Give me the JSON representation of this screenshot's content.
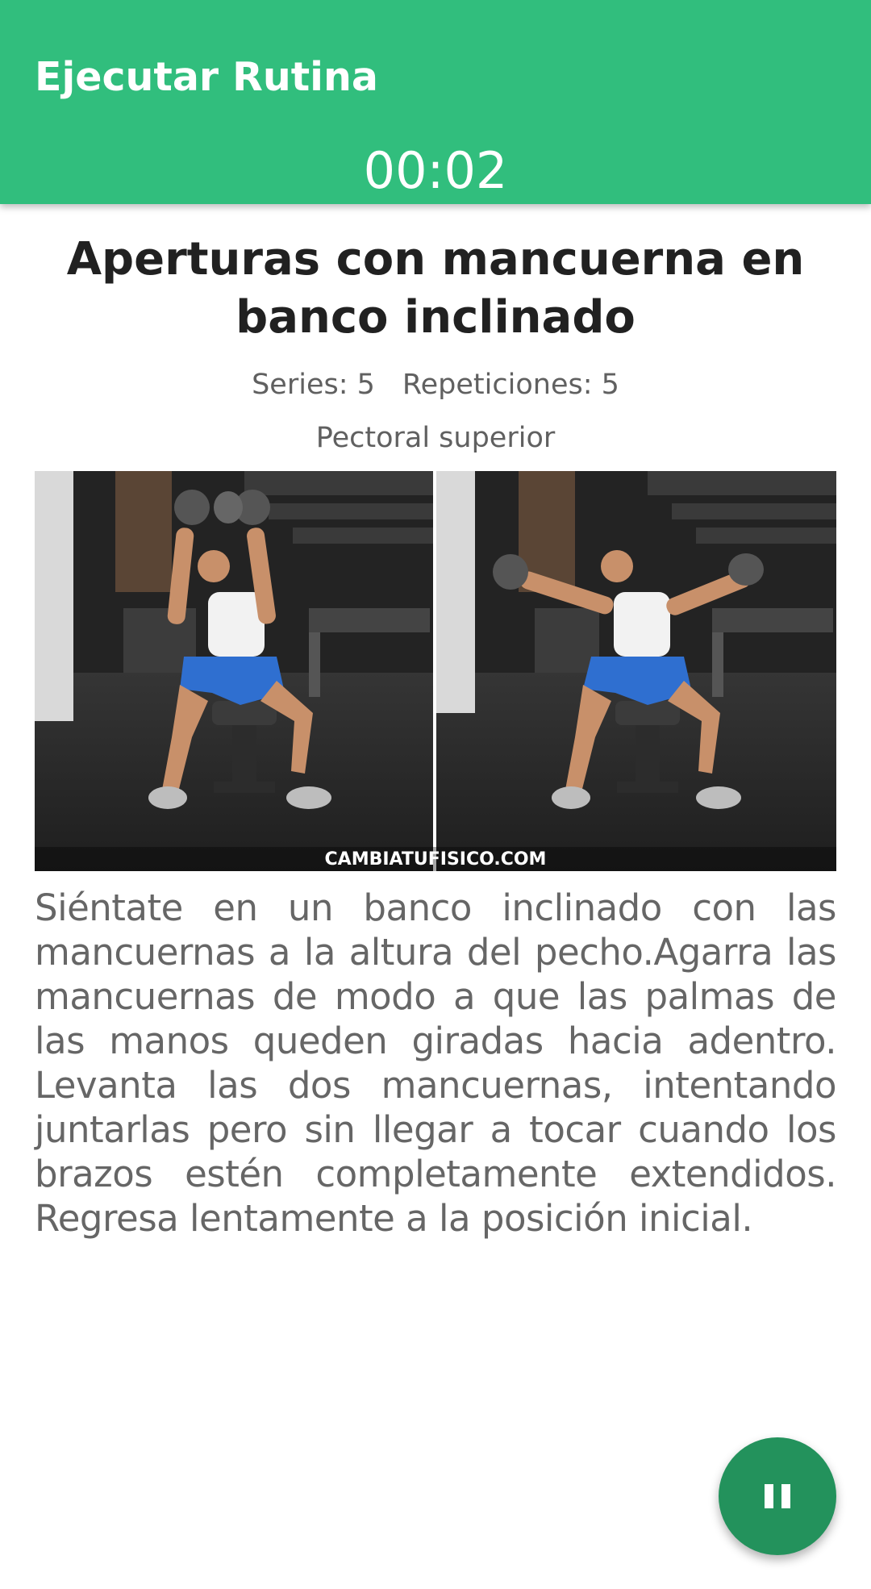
{
  "app_bar": {
    "title": "Ejecutar Rutina",
    "timer": "00:02",
    "color": "#31be7d"
  },
  "exercise": {
    "name": "Aperturas con mancuerna en banco inclinado",
    "series_label": "Series: 5",
    "repetitions_label": "Repeticiones: 5",
    "muscle": "Pectoral superior",
    "image": {
      "icon": "exercise-photo",
      "watermark": "CAMBIATUFISICO.COM"
    },
    "description": "Siéntate en un banco inclinado con las mancuernas a la altura del pecho.Agarra las mancuernas de modo a que las palmas de las manos queden giradas hacia adentro. Levanta las dos mancuernas, intentando juntarlas pero sin llegar a tocar cuando los brazos estén completamente extendidos. Regresa lentamente a la posición inicial."
  },
  "fab": {
    "icon": "pause-icon",
    "color": "#23925c"
  }
}
